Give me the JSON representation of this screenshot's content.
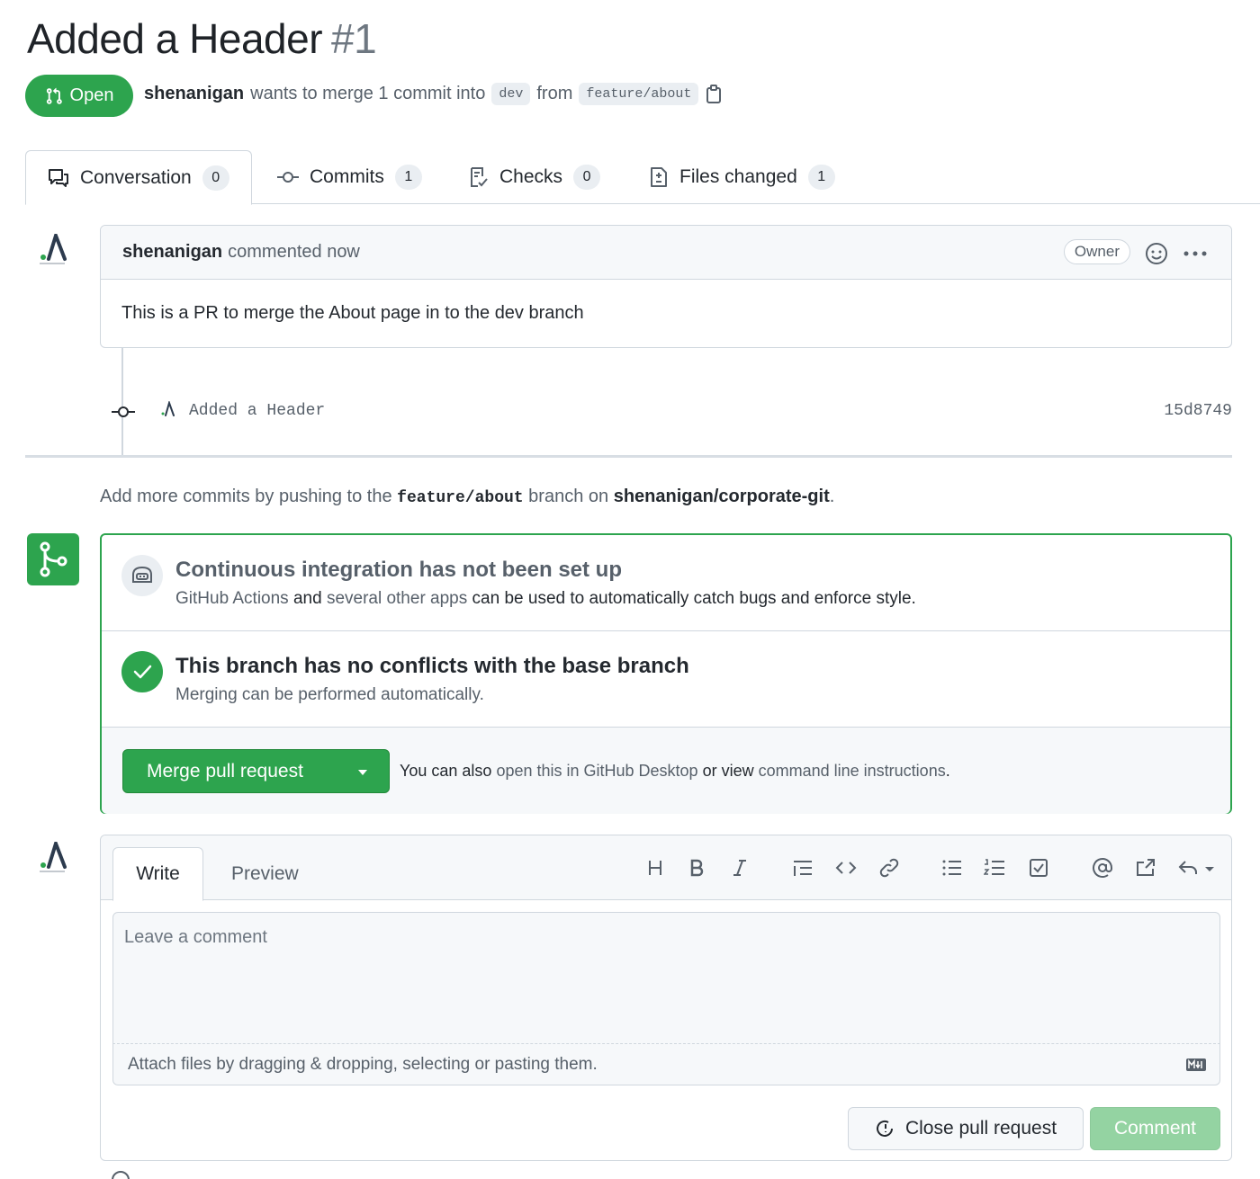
{
  "pr": {
    "title": "Added a Header",
    "number": "#1",
    "state": "Open",
    "author": "shenanigan",
    "merge_text": "wants to merge 1 commit into",
    "base_branch": "dev",
    "from_text": "from",
    "head_branch": "feature/about"
  },
  "tabs": [
    {
      "label": "Conversation",
      "count": "0",
      "icon": "comment-discussion-icon"
    },
    {
      "label": "Commits",
      "count": "1",
      "icon": "git-commit-icon"
    },
    {
      "label": "Checks",
      "count": "0",
      "icon": "checklist-icon"
    },
    {
      "label": "Files changed",
      "count": "1",
      "icon": "file-diff-icon"
    }
  ],
  "comment": {
    "author": "shenanigan",
    "action": "commented now",
    "badge": "Owner",
    "body": "This is a PR to merge the About page in to the dev branch"
  },
  "commit": {
    "message": "Added a Header",
    "sha": "15d8749"
  },
  "push_hint": {
    "prefix": "Add more commits by pushing to the",
    "branch": "feature/about",
    "middle": "branch on",
    "repo": "shenanigan/corporate-git",
    "suffix": "."
  },
  "merge_box": {
    "ci_title": "Continuous integration has not been set up",
    "ci_link1": "GitHub Actions",
    "ci_and": "and",
    "ci_link2": "several other apps",
    "ci_rest": "can be used to automatically catch bugs and enforce style.",
    "conflict_title": "This branch has no conflicts with the base branch",
    "conflict_sub": "Merging can be performed automatically.",
    "merge_button": "Merge pull request",
    "also_prefix": "You can also",
    "also_link1": "open this in GitHub Desktop",
    "also_or": "or view",
    "also_link2": "command line instructions",
    "also_suffix": "."
  },
  "editor": {
    "tab_write": "Write",
    "tab_preview": "Preview",
    "toolbar": [
      "heading-icon",
      "bold-icon",
      "italic-icon",
      "quote-icon",
      "code-icon",
      "link-icon",
      "unordered-list-icon",
      "ordered-list-icon",
      "tasklist-icon",
      "mention-icon",
      "cross-reference-icon",
      "reply-icon"
    ],
    "placeholder": "Leave a comment",
    "attach_text": "Attach files by dragging & dropping, selecting or pasting them.",
    "close_button": "Close pull request",
    "comment_button": "Comment"
  },
  "colors": {
    "success": "#2da44e",
    "link": "#0969da",
    "muted": "#57606a",
    "border": "#d0d7de"
  }
}
